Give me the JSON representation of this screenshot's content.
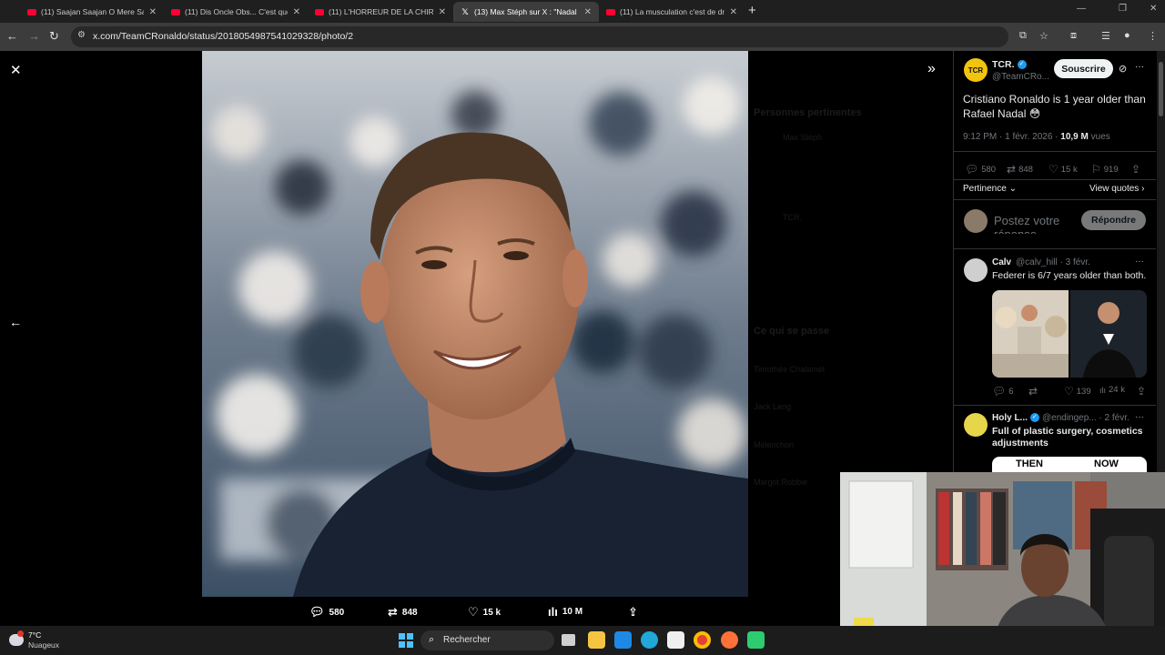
{
  "browser": {
    "tabs": [
      {
        "title": "(11) Saajan Saajan O Mere Saja",
        "kind": "youtube"
      },
      {
        "title": "(11) Dis Oncle Obs... C'est quoi",
        "kind": "youtube"
      },
      {
        "title": "(11) L'HORREUR DE LA CHIRUR",
        "kind": "youtube"
      },
      {
        "title": "(13) Max Stéph sur X : \"Nadal a",
        "kind": "x"
      },
      {
        "title": "(11) La musculation c'est de dr",
        "kind": "youtube"
      }
    ],
    "active_tab": 3,
    "url": "x.com/TeamCRonaldo/status/2018054987541029328/photo/2"
  },
  "media_viewer": {
    "actions": {
      "replies": "580",
      "reposts": "848",
      "likes": "15 k",
      "views": "10 M"
    },
    "background_panel": {
      "heading1": "Personnes pertinentes",
      "user1": "Max Stéph",
      "user2": "TCR.",
      "heading2": "Ce qui se passe",
      "trend1": "Timothée Chalamet",
      "trend2": "Jack Lang",
      "trend3": "Mélenchon",
      "trend4": "Margot Robbie"
    }
  },
  "main_tweet": {
    "display_name": "TCR.",
    "handle": "@TeamCRo...",
    "subscribe_label": "Souscrire",
    "text": "Cristiano Ronaldo is 1 year older than Rafael Nadal 😳",
    "time": "9:12 PM · 1 févr. 2026 · ",
    "views_count": "10,9 M",
    "views_label": " vues",
    "stats": {
      "replies": "580",
      "reposts": "848",
      "likes": "15 k",
      "bookmarks": "919"
    },
    "sort_label": "Pertinence",
    "quotes_link": "View quotes",
    "reply_placeholder": "Postez votre réponse",
    "reply_button": "Répondre"
  },
  "replies": [
    {
      "display_name": "Calv",
      "handle": "@calv_hill · 3 févr.",
      "text": "Federer is 6/7 years older than both.",
      "stats": {
        "replies": "6",
        "likes": "139",
        "views": "24 k"
      }
    },
    {
      "display_name": "Holy L...",
      "handle": "@endingep... · 2 févr.",
      "text": "Full of plastic surgery, cosmetics adjustments",
      "image_labels": [
        "THEN",
        "NOW"
      ]
    }
  ],
  "taskbar": {
    "weather_temp": "7°C",
    "weather_desc": "Nuageux",
    "search_label": "Rechercher"
  },
  "colors": {
    "x_blue": "#1d9bf0",
    "youtube_red": "#ff0033",
    "tcr_yellow": "#f1c40f"
  }
}
